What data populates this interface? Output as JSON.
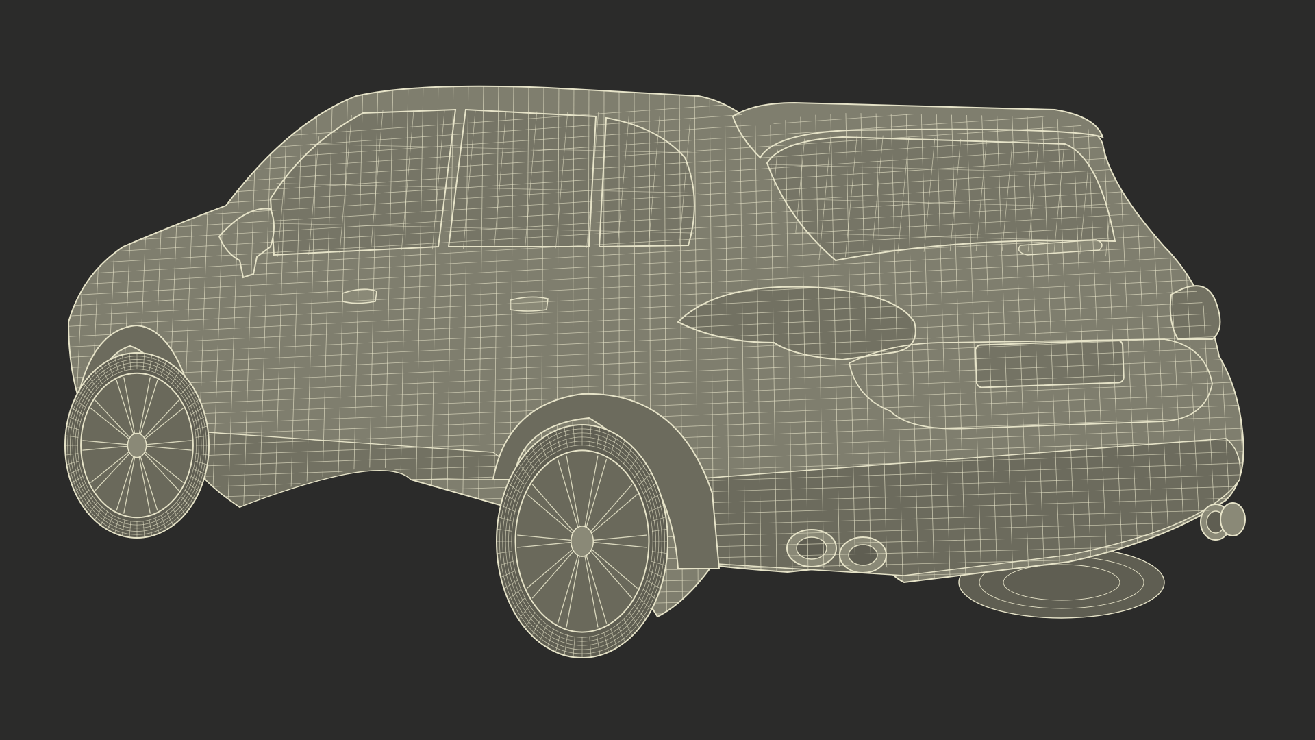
{
  "scene": {
    "subject": "suv-wireframe-render-rear-three-quarter",
    "background_color": "#2b2b2a",
    "shell_color": "#7f7e6e",
    "shell_shade_color": "#6c6b5d",
    "glass_color": "#767566",
    "tire_color": "#5f5e52",
    "wire_color": "#e6e3c8"
  }
}
